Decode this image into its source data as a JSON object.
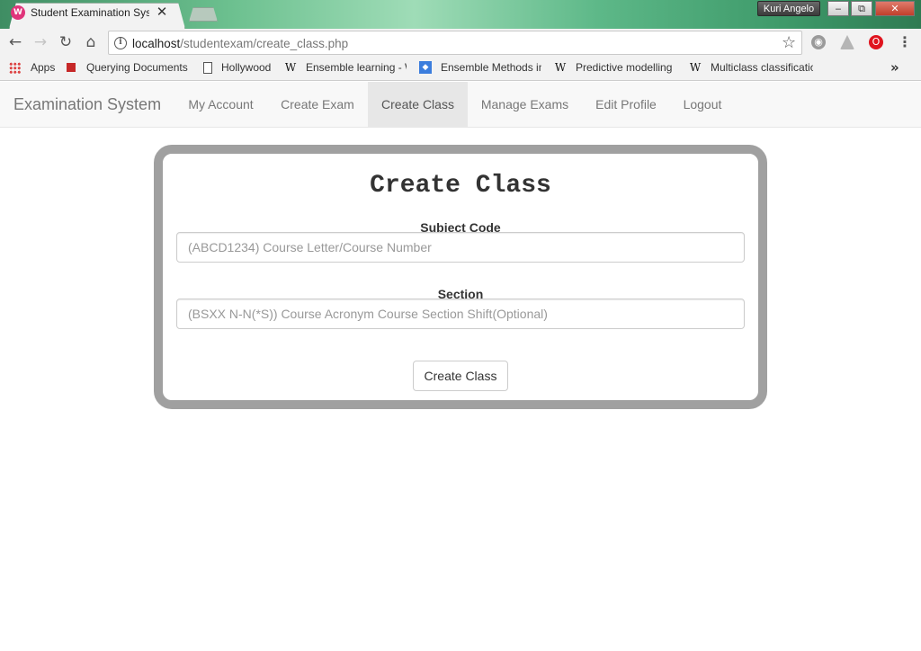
{
  "browser": {
    "tab": {
      "title": "Student Examination System",
      "favicon_text": "W"
    },
    "window_user": "Kuri Angelo",
    "window_buttons": {
      "minimize": "‒",
      "restore": "⧉",
      "close": "✕"
    },
    "address": {
      "host": "localhost",
      "path": "/studentexam/create_class.php"
    },
    "bookmarks": [
      {
        "label": "Apps",
        "icon": "apps-grid-icon"
      },
      {
        "label": "Querying Documents",
        "icon": "red-square-icon"
      },
      {
        "label": "Hollywood",
        "icon": "page-icon"
      },
      {
        "label": "Ensemble learning - W",
        "icon": "wikipedia-icon"
      },
      {
        "label": "Ensemble Methods in",
        "icon": "blue-diamond-icon"
      },
      {
        "label": "Predictive modelling",
        "icon": "wikipedia-icon"
      },
      {
        "label": "Multiclass classificatio",
        "icon": "wikipedia-icon"
      }
    ],
    "more_bookmarks": "»"
  },
  "navbar": {
    "brand": "Examination System",
    "links": [
      "My Account",
      "Create Exam",
      "Create Class",
      "Manage Exams",
      "Edit Profile",
      "Logout"
    ],
    "active": "Create Class"
  },
  "form": {
    "title": "Create Class",
    "subject_code": {
      "label": "Subject Code",
      "value": "",
      "placeholder": "(ABCD1234) Course Letter/Course Number"
    },
    "section": {
      "label": "Section",
      "value": "",
      "placeholder": "(BSXX N-N(*S)) Course Acronym Course Section Shift(Optional)"
    },
    "submit_label": "Create Class"
  },
  "colors": {
    "card_border": "#a0a0a0",
    "nav_active_bg": "#e7e7e7",
    "tab_favicon": "#e0357b"
  }
}
